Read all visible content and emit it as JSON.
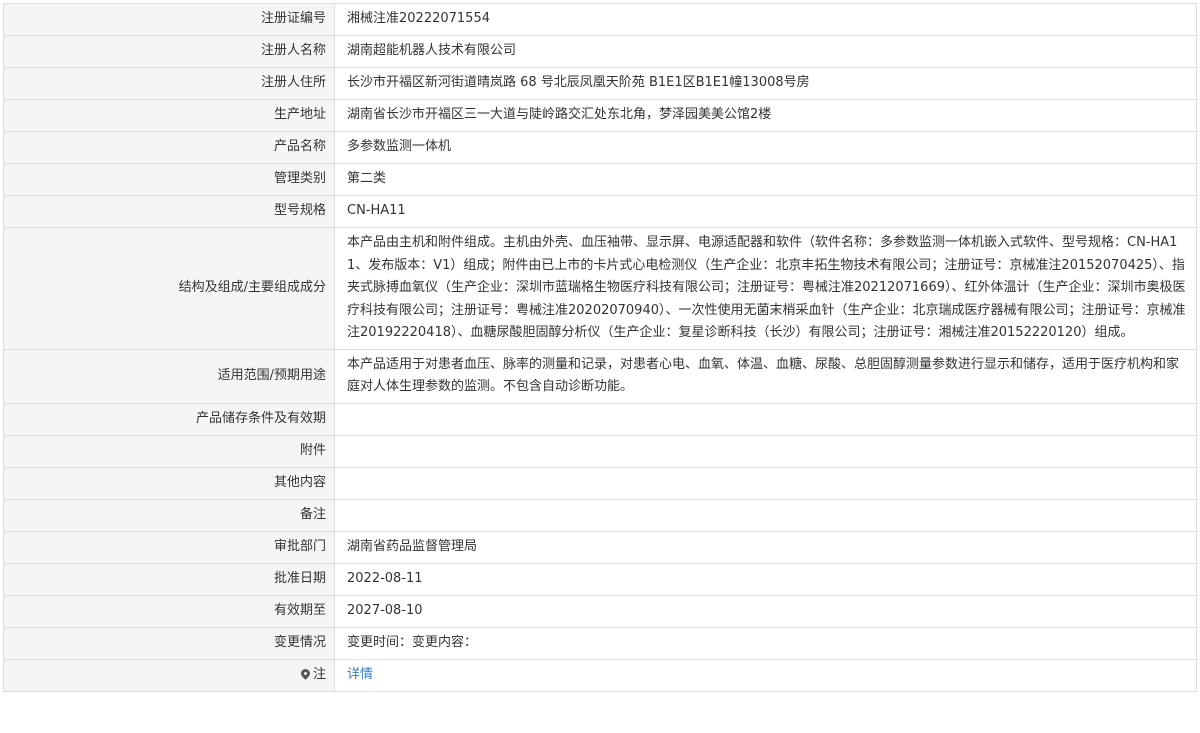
{
  "rows": {
    "reg_no": {
      "label": "注册证编号",
      "value": "湘械注准20222071554"
    },
    "registrant": {
      "label": "注册人名称",
      "value": "湖南超能机器人技术有限公司"
    },
    "registrant_address": {
      "label": "注册人住所",
      "value": "长沙市开福区新河街道晴岚路 68 号北辰凤凰天阶苑 B1E1区B1E1幢13008号房"
    },
    "production_address": {
      "label": "生产地址",
      "value": "湖南省长沙市开福区三一大道与陡岭路交汇处东北角，梦泽园美美公馆2楼"
    },
    "product_name": {
      "label": "产品名称",
      "value": "多参数监测一体机"
    },
    "management_class": {
      "label": "管理类别",
      "value": "第二类"
    },
    "model_spec": {
      "label": "型号规格",
      "value": "CN-HA11"
    },
    "structure": {
      "label": "结构及组成/主要组成成分",
      "value": "本产品由主机和附件组成。主机由外壳、血压袖带、显示屏、电源适配器和软件（软件名称：多参数监测一体机嵌入式软件、型号规格：CN-HA11、发布版本：V1）组成；附件由已上市的卡片式心电检测仪（生产企业：北京丰拓生物技术有限公司；注册证号：京械准注20152070425）、指夹式脉搏血氧仪（生产企业：深圳市蓝瑞格生物医疗科技有限公司；注册证号：粤械注准20212071669）、红外体温计（生产企业：深圳市奥极医疗科技有限公司；注册证号：粤械注准20202070940）、一次性使用无菌末梢采血针（生产企业：北京瑞成医疗器械有限公司；注册证号：京械准注20192220418）、血糖尿酸胆固醇分析仪（生产企业：复星诊断科技（长沙）有限公司；注册证号：湘械注准20152220120）组成。"
    },
    "intended_use": {
      "label": "适用范围/预期用途",
      "value": "本产品适用于对患者血压、脉率的测量和记录，对患者心电、血氧、体温、血糖、尿酸、总胆固醇测量参数进行显示和储存，适用于医疗机构和家庭对人体生理参数的监测。不包含自动诊断功能。"
    },
    "storage": {
      "label": "产品储存条件及有效期",
      "value": ""
    },
    "attachment": {
      "label": "附件",
      "value": ""
    },
    "other": {
      "label": "其他内容",
      "value": ""
    },
    "remarks": {
      "label": "备注",
      "value": ""
    },
    "approval_dept": {
      "label": "审批部门",
      "value": "湖南省药品监督管理局"
    },
    "approval_date": {
      "label": "批准日期",
      "value": "2022-08-11"
    },
    "valid_until": {
      "label": "有效期至",
      "value": "2027-08-10"
    },
    "changes": {
      "label": "变更情况",
      "value": "变更时间：变更内容："
    },
    "note": {
      "label": "注",
      "icon": "map-pin-icon",
      "link_text": "详情"
    }
  },
  "colors": {
    "label_bg": "#f5f5f5",
    "border": "#dddddd",
    "text": "#333333",
    "link": "#2f7ec1"
  }
}
